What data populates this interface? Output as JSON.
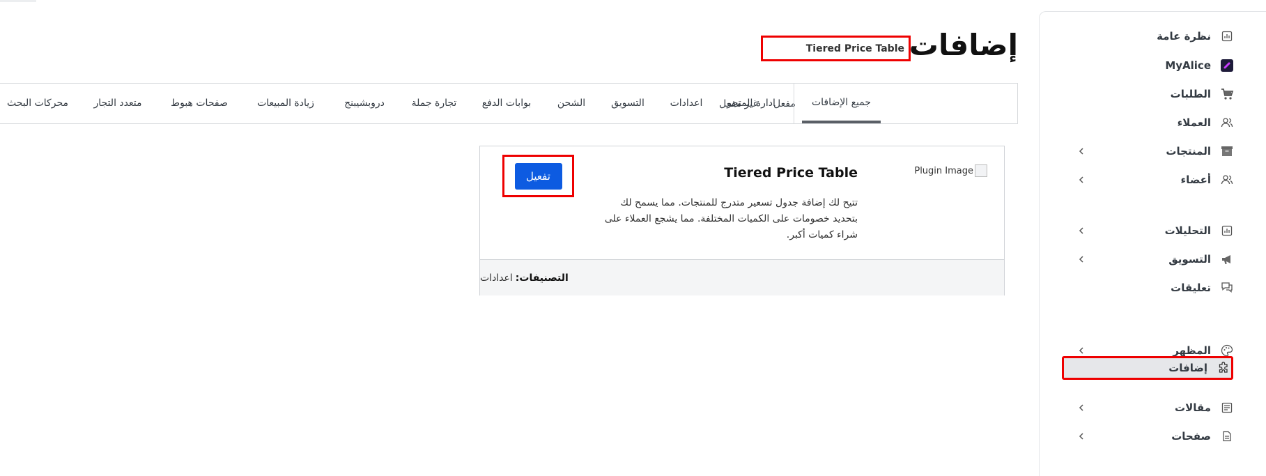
{
  "page": {
    "title": "إضافات"
  },
  "breadcrumb": {
    "current": "Tiered Price Table"
  },
  "sidebar": {
    "items": [
      {
        "label": "نظرة عامة",
        "icon": "chart-icon",
        "chevron": false
      },
      {
        "label": "MyAlice",
        "icon": "myalice-logo-icon",
        "chevron": false
      },
      {
        "label": "الطلبات",
        "icon": "cart-icon",
        "chevron": false
      },
      {
        "label": "العملاء",
        "icon": "users-icon",
        "chevron": false
      },
      {
        "label": "المنتجات",
        "icon": "box-icon",
        "chevron": true
      },
      {
        "label": "أعضاء",
        "icon": "members-icon",
        "chevron": true
      },
      {
        "label": "التحليلات",
        "icon": "analytics-icon",
        "chevron": true
      },
      {
        "label": "التسويق",
        "icon": "megaphone-icon",
        "chevron": true
      },
      {
        "label": "تعليقات",
        "icon": "comments-icon",
        "chevron": false
      },
      {
        "label": "المظهر",
        "icon": "palette-icon",
        "chevron": true
      },
      {
        "label": "إضافات",
        "icon": "puzzle-icon",
        "chevron": false,
        "active": true
      },
      {
        "label": "مقالات",
        "icon": "articles-icon",
        "chevron": true
      },
      {
        "label": "صفحات",
        "icon": "page-icon",
        "chevron": true
      }
    ]
  },
  "tabs": [
    {
      "label": "جميع الإضافات",
      "active": true
    },
    {
      "label": "مفعل"
    },
    {
      "label": "غير مفعل"
    },
    {
      "label": "ادارة المتجر"
    },
    {
      "label": "اعدادات"
    },
    {
      "label": "التسويق"
    },
    {
      "label": "الشحن"
    },
    {
      "label": "بوابات الدفع"
    },
    {
      "label": "تجارة جملة"
    },
    {
      "label": "دروبشيبنج"
    },
    {
      "label": "زيادة المبيعات"
    },
    {
      "label": "صفحات هبوط"
    },
    {
      "label": "متعدد التجار"
    },
    {
      "label": "محركات البحث"
    }
  ],
  "plugin": {
    "image_alt": "Plugin Image",
    "title": "Tiered Price Table",
    "description": "تتيح لك إضافة جدول تسعير متدرج للمنتجات. مما يسمح لك بتحديد خصومات على الكميات المختلفة. مما يشجع العملاء على شراء كميات أكبر.",
    "activate_label": "تفعيل",
    "categories_key": "التصنيفات:",
    "categories_value": "اعدادات"
  },
  "colors": {
    "accent": "#0d5be1",
    "highlight": "#ee0000",
    "active_bg": "#e6e7ea"
  }
}
